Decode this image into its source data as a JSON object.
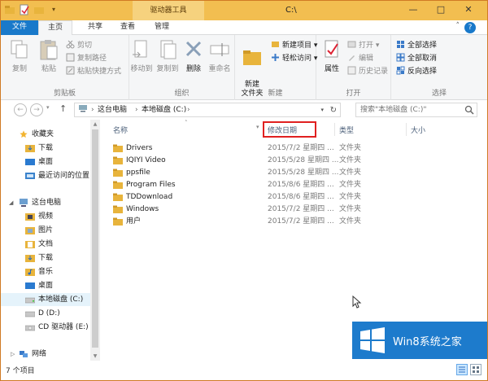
{
  "window": {
    "title": "C:\\",
    "context_tab": "驱动器工具",
    "controls": {
      "minimize": "—",
      "maximize": "□",
      "close": "✕"
    }
  },
  "ribbon_tabs": {
    "file": "文件",
    "home": "主页",
    "share": "共享",
    "view": "查看",
    "manage": "管理"
  },
  "ribbon": {
    "clipboard": {
      "label": "剪贴板",
      "copy": "复制",
      "paste": "粘贴",
      "cut": "剪切",
      "copy_path": "复制路径",
      "paste_shortcut": "粘贴快捷方式"
    },
    "organize": {
      "label": "组织",
      "move_to": "移动到",
      "copy_to": "复制到",
      "delete": "删除",
      "rename": "重命名"
    },
    "new": {
      "label": "新建",
      "new_folder": "新建\n文件夹",
      "new_item": "新建项目 ▾",
      "easy_access": "轻松访问 ▾"
    },
    "open": {
      "label": "打开",
      "properties": "属性",
      "open": "打开 ▾",
      "edit": "编辑",
      "history": "历史记录"
    },
    "select": {
      "label": "选择",
      "select_all": "全部选择",
      "select_none": "全部取消",
      "invert": "反向选择"
    }
  },
  "navigation": {
    "back": "←",
    "forward": "→",
    "up": "↑",
    "address": [
      "这台电脑",
      "本地磁盘 (C:)"
    ],
    "search_placeholder": "搜索\"本地磁盘 (C:)\""
  },
  "nav_pane": {
    "favorites": "收藏夹",
    "fav_items": [
      "下载",
      "桌面",
      "最近访问的位置"
    ],
    "this_pc": "这台电脑",
    "pc_items": [
      "视频",
      "图片",
      "文档",
      "下载",
      "音乐",
      "桌面"
    ],
    "drives": [
      "本地磁盘 (C:)",
      "D (D:)",
      "CD 驱动器 (E:)"
    ],
    "network": "网络"
  },
  "columns": {
    "name": "名称",
    "date": "修改日期",
    "type": "类型",
    "size": "大小"
  },
  "files": [
    {
      "name": "Drivers",
      "date": "2015/7/2 星期四 ...",
      "type": "文件夹"
    },
    {
      "name": "IQIYI Video",
      "date": "2015/5/28 星期四 ...",
      "type": "文件夹"
    },
    {
      "name": "ppsfile",
      "date": "2015/5/28 星期四 ...",
      "type": "文件夹"
    },
    {
      "name": "Program Files",
      "date": "2015/8/6 星期四 ...",
      "type": "文件夹"
    },
    {
      "name": "TDDownload",
      "date": "2015/8/6 星期四 ...",
      "type": "文件夹"
    },
    {
      "name": "Windows",
      "date": "2015/7/2 星期四 ...",
      "type": "文件夹"
    },
    {
      "name": "用户",
      "date": "2015/7/2 星期四 ...",
      "type": "文件夹"
    }
  ],
  "status": {
    "item_count": "7 个项目"
  },
  "watermark": {
    "text": "Win8系统之家"
  },
  "colors": {
    "accent": "#1979ca",
    "title_bar": "#f2be50",
    "highlight": "#e02020",
    "folder": "#e8b43c"
  }
}
